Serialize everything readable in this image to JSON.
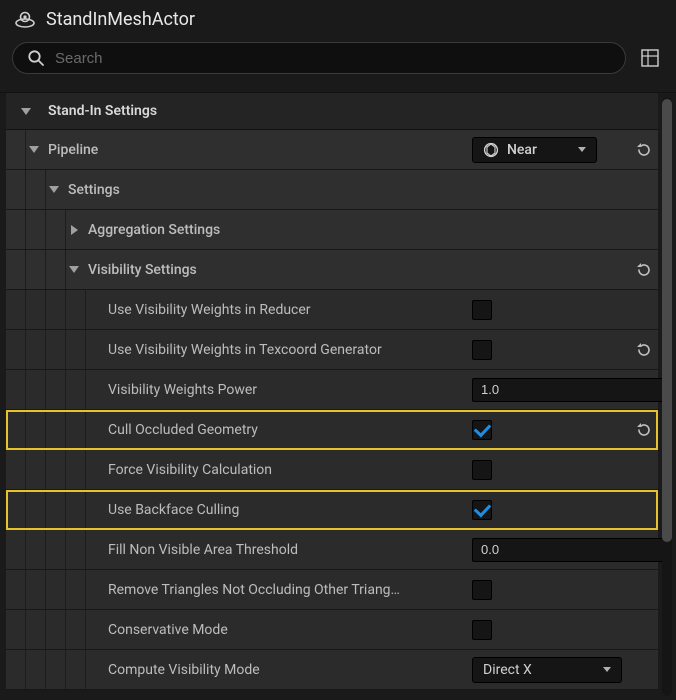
{
  "header": {
    "title": "StandInMeshActor"
  },
  "search": {
    "placeholder": "Search"
  },
  "section": {
    "title": "Stand-In Settings",
    "pipeline": {
      "label": "Pipeline",
      "value": "Near",
      "settings": {
        "label": "Settings",
        "aggregation": {
          "label": "Aggregation Settings"
        },
        "visibility": {
          "label": "Visibility Settings",
          "rows": [
            {
              "label": "Use Visibility Weights in Reducer",
              "type": "bool",
              "value": false
            },
            {
              "label": "Use Visibility Weights in Texcoord Generator",
              "type": "bool",
              "value": false,
              "reset": true
            },
            {
              "label": "Visibility Weights Power",
              "type": "number",
              "value": "1.0"
            },
            {
              "label": "Cull Occluded Geometry",
              "type": "bool",
              "value": true,
              "highlight": true,
              "reset": true
            },
            {
              "label": "Force Visibility Calculation",
              "type": "bool",
              "value": false
            },
            {
              "label": "Use Backface Culling",
              "type": "bool",
              "value": true,
              "highlight": true
            },
            {
              "label": "Fill Non Visible Area Threshold",
              "type": "number",
              "value": "0.0"
            },
            {
              "label": "Remove Triangles Not Occluding Other Triang…",
              "type": "bool",
              "value": false
            },
            {
              "label": "Conservative Mode",
              "type": "bool",
              "value": false
            },
            {
              "label": "Compute Visibility Mode",
              "type": "enum",
              "value": "Direct X"
            }
          ]
        }
      }
    }
  }
}
